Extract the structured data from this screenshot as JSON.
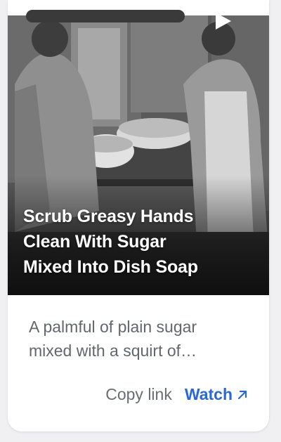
{
  "card": {
    "headline_lines": [
      "Scrub Greasy Hands",
      "Clean With Sugar",
      "Mixed Into Dish Soap"
    ],
    "summary_lines": [
      "A palmful of plain sugar",
      "mixed with a squirt of…"
    ],
    "actions": {
      "copy_link_label": "Copy link",
      "watch_label": "Watch"
    }
  },
  "icons": {
    "play": "play-icon",
    "watch_arrow": "arrow-up-right-icon"
  },
  "colors": {
    "accent": "#2a67d8",
    "muted_text": "#63666d",
    "card_bg": "#ffffff",
    "page_bg": "#f0f0f3"
  }
}
